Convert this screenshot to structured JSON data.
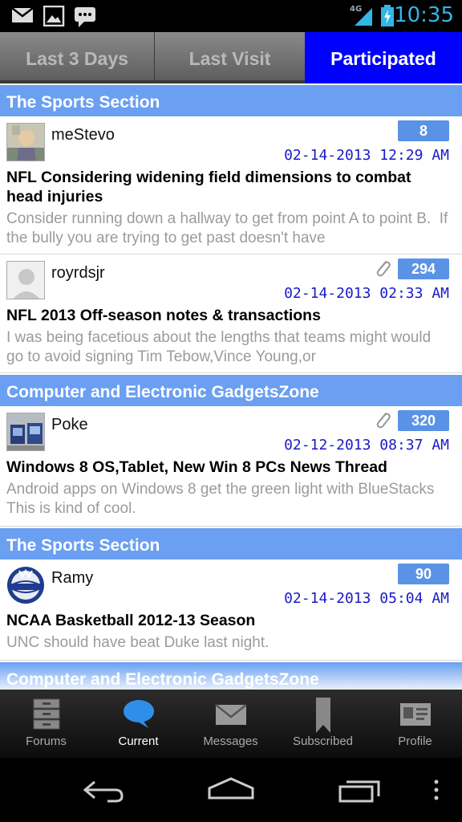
{
  "status_bar": {
    "time": "10:35",
    "network": "4G",
    "icons": [
      "mail-icon",
      "image-icon",
      "chat-icon",
      "signal-icon",
      "battery-icon"
    ]
  },
  "tabs": [
    {
      "label": "Last 3 Days",
      "active": false
    },
    {
      "label": "Last Visit",
      "active": false
    },
    {
      "label": "Participated",
      "active": true
    }
  ],
  "groups": [
    {
      "section": "The Sports Section",
      "threads": [
        {
          "username": "meStevo",
          "count": "8",
          "attachment": false,
          "date": "02-14-2013 12:29 AM",
          "title": "NFL Considering widening field dimensions to combat head injuries",
          "preview": "Consider running down a hallway to get from point A to point B.  If the bully you are trying to get past doesn't have"
        },
        {
          "username": "royrdsjr",
          "count": "294",
          "attachment": true,
          "date": "02-14-2013 02:33 AM",
          "title": "NFL 2013 Off-season notes & transactions",
          "preview": "I was being facetious about the lengths that teams might would go to avoid signing Tim Tebow,Vince Young,or"
        }
      ]
    },
    {
      "section": "Computer and Electronic GadgetsZone",
      "threads": [
        {
          "username": "Poke",
          "count": "320",
          "attachment": true,
          "date": "02-12-2013 08:37 AM",
          "title": "Windows 8 OS,Tablet, New Win 8 PCs News Thread",
          "preview": "Android apps on Windows 8 get the green light with BlueStacks  This is kind of cool."
        }
      ]
    },
    {
      "section": "The Sports Section",
      "threads": [
        {
          "username": "Ramy",
          "count": "90",
          "attachment": false,
          "date": "02-14-2013 05:04 AM",
          "title": "NCAA Basketball 2012-13 Season",
          "preview": "UNC should have beat Duke last night."
        }
      ]
    },
    {
      "section": "Computer and Electronic GadgetsZone",
      "threads": []
    }
  ],
  "bottom_nav": [
    {
      "label": "Forums",
      "icon": "forums-icon",
      "active": false
    },
    {
      "label": "Current",
      "icon": "current-icon",
      "active": true
    },
    {
      "label": "Messages",
      "icon": "messages-icon",
      "active": false
    },
    {
      "label": "Subscribed",
      "icon": "subscribed-icon",
      "active": false
    },
    {
      "label": "Profile",
      "icon": "profile-icon",
      "active": false
    }
  ],
  "system_nav": [
    "back-icon",
    "home-icon",
    "recents-icon",
    "menu-icon"
  ],
  "colors": {
    "section_header": "#6a9ff1",
    "active_tab": "#0000ff",
    "date_text": "#1a1ac8",
    "count_badge": "#5a93e6",
    "clock": "#33b5e5"
  }
}
